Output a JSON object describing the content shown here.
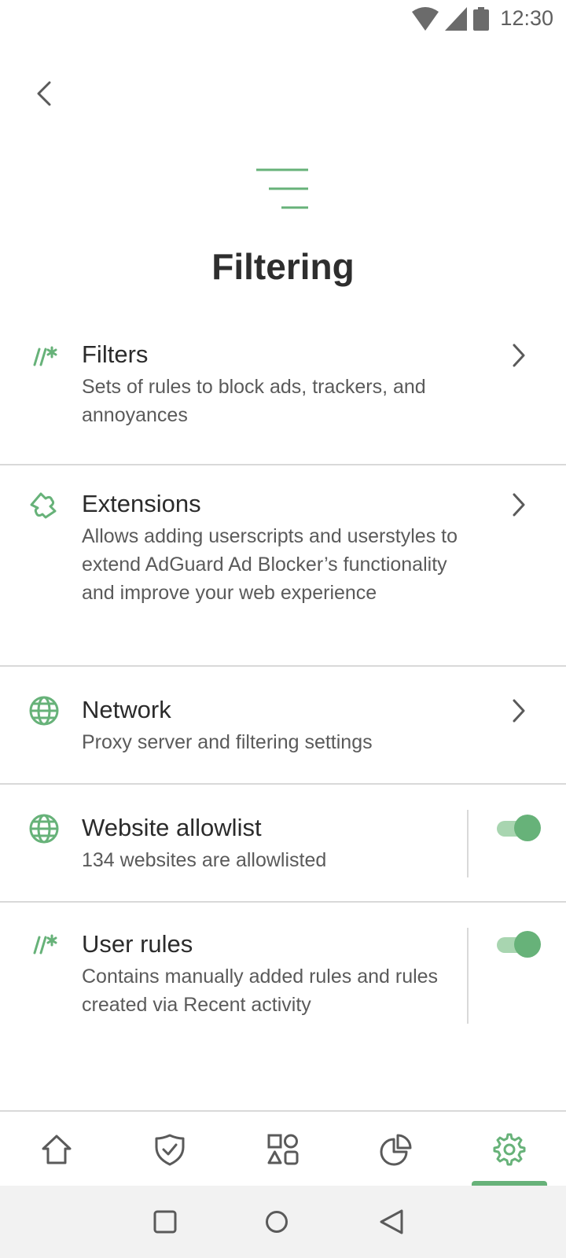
{
  "status_bar": {
    "time": "12:30",
    "icons": [
      "wifi-icon",
      "signal-icon",
      "battery-icon"
    ]
  },
  "header": {
    "back_icon": "back-arrow-icon",
    "header_icon": "filter-lines-icon",
    "title": "Filtering"
  },
  "settings": [
    {
      "title": "Filters",
      "description": "Sets of rules to block ads, trackers, and annoyances",
      "icon": "filter-rules-icon",
      "control": "chevron"
    },
    {
      "title": "Extensions",
      "description": "Allows adding userscripts and userstyles to extend AdGuard Ad Blocker’s functionality and improve your web experience",
      "icon": "puzzle-icon",
      "control": "chevron"
    },
    {
      "title": "Network",
      "description": "Proxy server and filtering settings",
      "icon": "globe-icon",
      "control": "chevron"
    },
    {
      "title": "Website allowlist",
      "description": "134 websites are allowlisted",
      "icon": "globe-icon",
      "control": "toggle",
      "enabled": true
    },
    {
      "title": "User rules",
      "description": "Contains manually added rules and rules created via Recent activity",
      "icon": "filter-rules-icon",
      "control": "toggle",
      "enabled": true
    }
  ],
  "bottom_nav": {
    "items": [
      "home-icon",
      "shield-icon",
      "apps-icon",
      "statistics-icon",
      "settings-icon"
    ],
    "active": "settings-icon"
  },
  "colors": {
    "accent": "#67b279",
    "accent_light": "#a8d5b0",
    "divider": "#d9d9d9",
    "text_primary": "#2b2b2b",
    "text_secondary": "#5a5a5a",
    "system_nav_bg": "#f2f2f2"
  }
}
